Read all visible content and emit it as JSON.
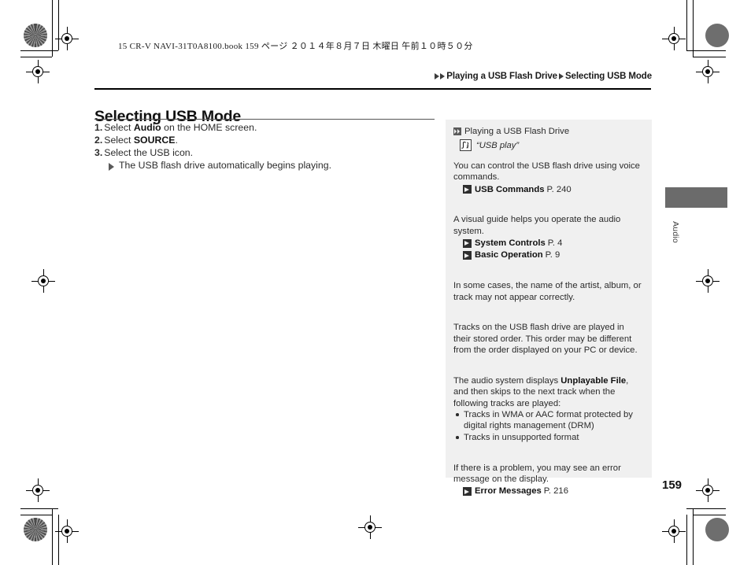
{
  "book": {
    "print_line": "15 CR-V NAVI-31T0A8100.book   159 ページ   ２０１４年８月７日   木曜日   午前１０時５０分",
    "folio": "159",
    "side_tab_label": "Audio"
  },
  "breadcrumb": {
    "parent": "Playing a USB Flash Drive",
    "current": "Selecting USB Mode"
  },
  "main": {
    "title": "Selecting USB Mode",
    "steps": [
      {
        "num": "1.",
        "pre": "Select ",
        "bold": "Audio",
        "post": " on the HOME screen."
      },
      {
        "num": "2.",
        "pre": "Select ",
        "bold": "SOURCE",
        "post": "."
      },
      {
        "num": "3.",
        "pre": "Select the USB icon.",
        "bold": "",
        "post": ""
      }
    ],
    "substep": "The USB flash drive automatically begins playing."
  },
  "sidenote": {
    "heading": "Playing a USB Flash Drive",
    "voice_icon": "voice-command-icon",
    "voice_command": "“USB play”",
    "para_voice": "You can control the USB flash drive using voice commands.",
    "ref_voice": {
      "title": "USB Commands",
      "page": "P. 240"
    },
    "para_guide": "A visual guide helps you operate the audio system.",
    "ref_guide_1": {
      "title": "System Controls",
      "page": "P. 4"
    },
    "ref_guide_2": {
      "title": "Basic Operation",
      "page": "P. 9"
    },
    "para_names": "In some cases, the name of the artist, album, or track may not appear correctly.",
    "para_order": "Tracks on the USB flash drive are played in their stored order. This order may be different from the order displayed on your PC or device.",
    "para_unplayable_pre": "The audio system displays ",
    "para_unplayable_bold": "Unplayable File",
    "para_unplayable_post": ", and then skips to the next track when the following tracks are played:",
    "bullets": [
      "Tracks in WMA or AAC format protected by digital rights management (DRM)",
      "Tracks in unsupported format"
    ],
    "para_error": "If there is a problem, you may see an error message on the display.",
    "ref_error": {
      "title": "Error Messages",
      "page": "P. 216"
    }
  },
  "colors": {
    "panel_bg": "#f0f0f0",
    "tab_bar": "#6b6b6b",
    "text": "#2b2b2b",
    "rule": "#000000"
  }
}
